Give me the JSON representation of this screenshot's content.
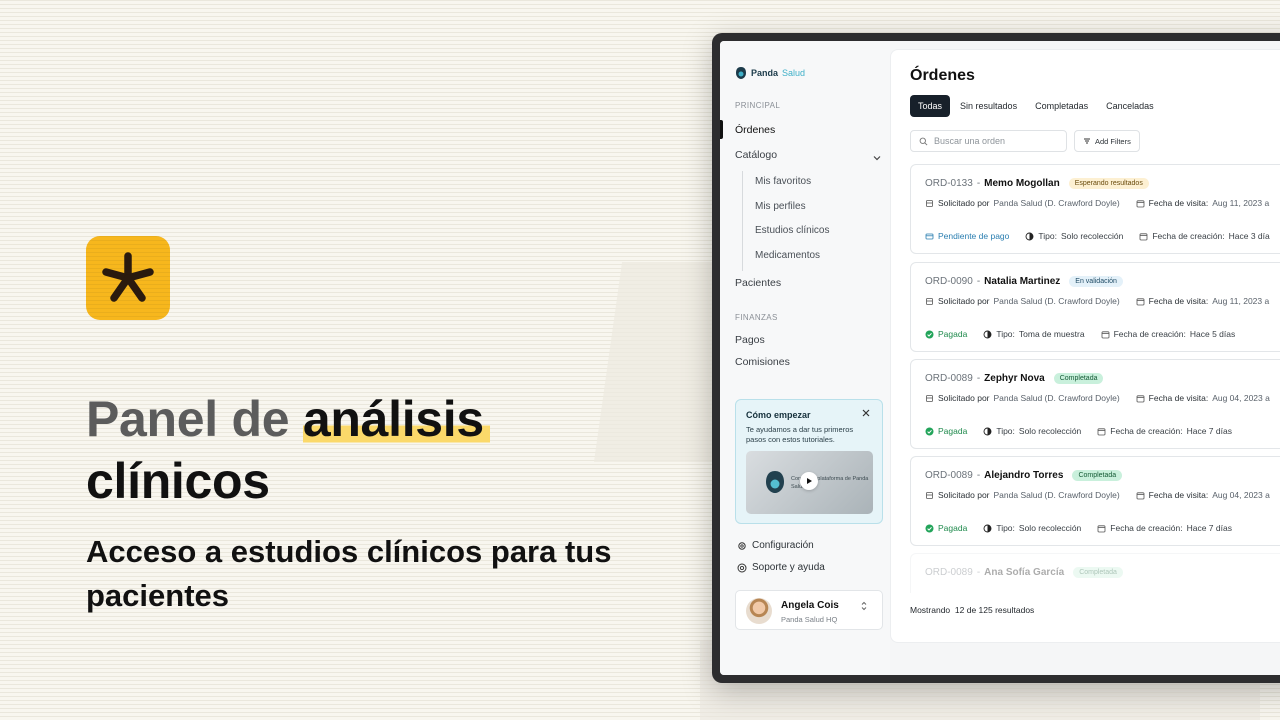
{
  "hero": {
    "title_part1": "Panel de ",
    "title_highlight": "análisis",
    "title_part2": "clínicos",
    "subtitle": "Acceso a estudios clínicos para tus pacientes"
  },
  "colors": {
    "logo_bg": "#f7b71d",
    "highlight": "#fbd96a",
    "primary_dark": "#17202a",
    "accent_teal": "#3fb0c8"
  },
  "sidebar": {
    "brand_left": "Panda",
    "brand_right": "Salud",
    "section_principal": "PRINCIPAL",
    "items": {
      "ordenes": "Órdenes",
      "catalogo": "Catálogo",
      "pacientes": "Pacientes"
    },
    "catalog_sub": [
      "Mis favoritos",
      "Mis perfiles",
      "Estudios clínicos",
      "Medicamentos"
    ],
    "section_finanzas": "FINANZAS",
    "finance_items": [
      "Pagos",
      "Comisiones"
    ],
    "promo": {
      "title": "Cómo empezar",
      "text": "Te ayudamos a dar tus primeros pasos con estos tutoriales.",
      "video_text": "Conoce la plataforma de Panda Salud"
    },
    "config": "Configuración",
    "support": "Soporte y ayuda",
    "user": {
      "name": "Angela Cois",
      "org": "Panda Salud HQ"
    }
  },
  "main": {
    "title": "Órdenes",
    "tabs": [
      "Todas",
      "Sin resultados",
      "Completadas",
      "Canceladas"
    ],
    "active_tab": "Todas",
    "search_placeholder": "Buscar una orden",
    "filters_label": "Add Filters",
    "labels": {
      "requested_by": "Solicitado por",
      "visit_date": "Fecha de visita:",
      "type": "Tipo:",
      "created": "Fecha de creación:"
    },
    "orders": [
      {
        "id": "ORD-0133",
        "patient": "Memo Mogollan",
        "status": "Esperando resultados",
        "requester": "Panda Salud (D. Crawford Doyle)",
        "visit": "Aug 11, 2023 a",
        "payment": "Pendiente de pago",
        "type": "Solo recolección",
        "created": "Hace 3 día"
      },
      {
        "id": "ORD-0090",
        "patient": "Natalia Martinez",
        "status": "En validación",
        "requester": "Panda Salud (D. Crawford Doyle)",
        "visit": "Aug 11, 2023 a",
        "payment": "Pagada",
        "type": "Toma de muestra",
        "created": "Hace 5 días"
      },
      {
        "id": "ORD-0089",
        "patient": "Zephyr Nova",
        "status": "Completada",
        "requester": "Panda Salud (D. Crawford Doyle)",
        "visit": "Aug 04, 2023 a",
        "payment": "Pagada",
        "type": "Solo recolección",
        "created": "Hace 7 días"
      },
      {
        "id": "ORD-0089",
        "patient": "Alejandro Torres",
        "status": "Completada",
        "requester": "Panda Salud (D. Crawford Doyle)",
        "visit": "Aug 04, 2023 a",
        "payment": "Pagada",
        "type": "Solo recolección",
        "created": "Hace 7 días"
      },
      {
        "id": "ORD-0089",
        "patient": "Ana Sofía García",
        "status": "Completada"
      }
    ],
    "footer_prefix": "Mostrando",
    "footer_count": "12 de 125 resultados"
  }
}
